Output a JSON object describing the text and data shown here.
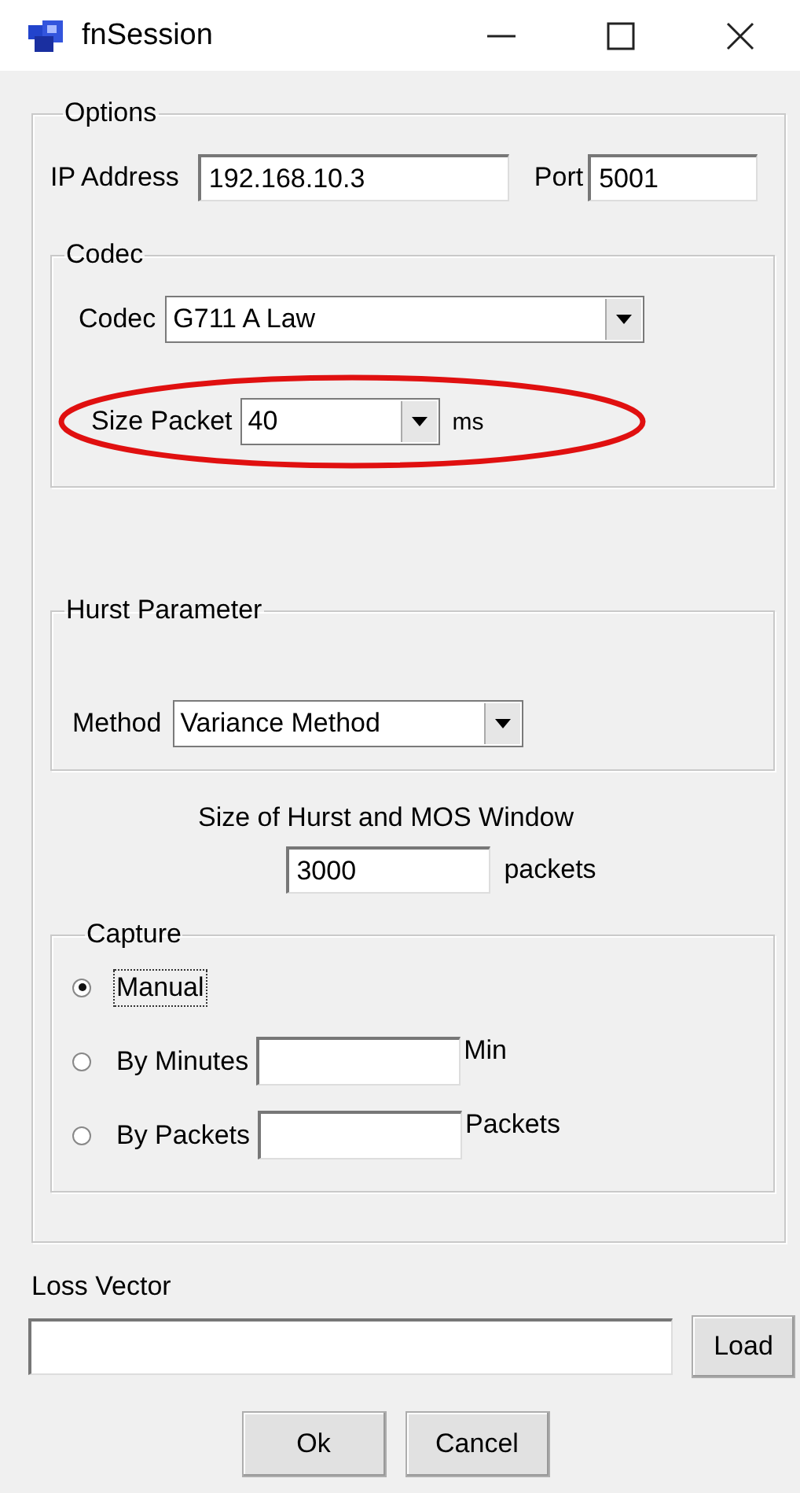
{
  "window": {
    "title": "fnSession"
  },
  "options": {
    "legend": "Options",
    "ip_label": "IP Address",
    "ip_value": "192.168.10.3",
    "port_label": "Port",
    "port_value": "5001",
    "codec": {
      "legend": "Codec",
      "codec_label": "Codec",
      "codec_value": "G711 A Law",
      "size_label": "Size Packet",
      "size_value": "40",
      "size_unit": "ms",
      "highlighted": true
    },
    "hurst": {
      "legend": "Hurst Parameter",
      "method_label": "Method",
      "method_value": "Variance Method"
    },
    "window_size": {
      "label": "Size of Hurst and MOS Window",
      "value": "3000",
      "unit": "packets"
    },
    "capture": {
      "legend": "Capture",
      "options": [
        {
          "label": "Manual",
          "selected": true,
          "kind": "plain"
        },
        {
          "label": "By Minutes",
          "selected": false,
          "kind": "field",
          "unit": "Min"
        },
        {
          "label": "By Packets",
          "selected": false,
          "kind": "field",
          "unit": "Packets"
        }
      ]
    }
  },
  "loss_vector": {
    "label": "Loss Vector",
    "button": "Load"
  },
  "buttons": [
    "Ok",
    "Cancel"
  ]
}
